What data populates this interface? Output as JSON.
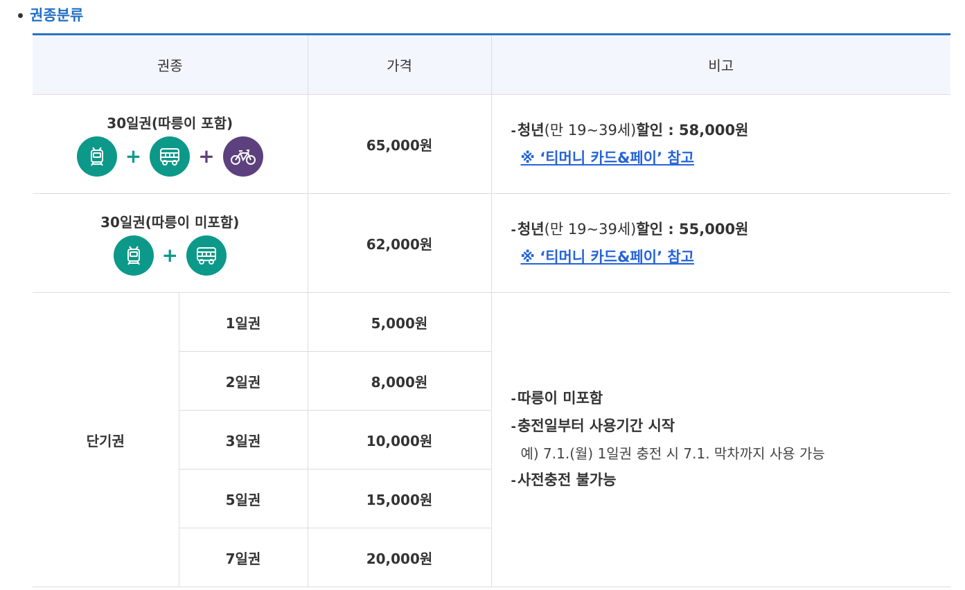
{
  "section": {
    "title": "권종분류"
  },
  "table": {
    "headers": {
      "type": "권종",
      "price": "가격",
      "note": "비고"
    },
    "passes": [
      {
        "name": "30일권(따릉이 포함)",
        "icons": [
          "subway-icon",
          "bus-icon",
          "bicycle-icon"
        ],
        "price": "65,000원",
        "note": {
          "prefix": "청년",
          "paren": "(만 19~39세)",
          "suffix": "할인 : 58,000원",
          "link": "※ ‘티머니 카드&페이’ 참고"
        }
      },
      {
        "name": "30일권(따릉이 미포함)",
        "icons": [
          "subway-icon",
          "bus-icon"
        ],
        "price": "62,000원",
        "note": {
          "prefix": "청년",
          "paren": "(만 19~39세)",
          "suffix": "할인 : 55,000원",
          "link": "※ ‘티머니 카드&페이’ 참고"
        }
      }
    ],
    "short_term": {
      "group_label": "단기권",
      "rows": [
        {
          "name": "1일권",
          "price": "5,000원"
        },
        {
          "name": "2일권",
          "price": "8,000원"
        },
        {
          "name": "3일권",
          "price": "10,000원"
        },
        {
          "name": "5일권",
          "price": "15,000원"
        },
        {
          "name": "7일권",
          "price": "20,000원"
        }
      ],
      "notes": {
        "line1": "따릉이 미포함",
        "line2": "충전일부터 사용기간 시작",
        "example": "예) 7.1.(월) 1일권 충전 시 7.1. 막차까지 사용 가능",
        "line3": "사전충전 불가능"
      }
    }
  },
  "colors": {
    "accent_blue": "#2a72c3",
    "title_blue": "#1f6fc5",
    "teal": "#0c9989",
    "purple": "#5c417e",
    "link": "#2563d9"
  }
}
